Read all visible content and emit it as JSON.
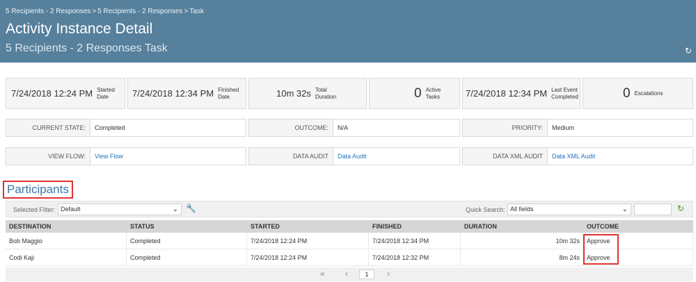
{
  "breadcrumb": [
    "5 Recipients - 2 Responses",
    "5 Recipients - 2 Responses",
    "Task"
  ],
  "header": {
    "title": "Activity Instance Detail",
    "subtitle": "5 Recipients - 2 Responses Task",
    "refresh_icon": "refresh-icon"
  },
  "stats": [
    {
      "value": "7/24/2018 12:24 PM",
      "label": "Started Date"
    },
    {
      "value": "7/24/2018 12:34 PM",
      "label": "Finished Date"
    },
    {
      "value": "10m 32s",
      "label": "Total Duration"
    },
    {
      "value": "0",
      "label": "Active Tasks"
    },
    {
      "value": "7/24/2018 12:34 PM",
      "label": "Last Event Completed"
    },
    {
      "value": "0",
      "label": "Escalations"
    }
  ],
  "info": {
    "current_state": {
      "key": "CURRENT STATE:",
      "value": "Completed"
    },
    "outcome": {
      "key": "OUTCOME:",
      "value": "N/A"
    },
    "priority": {
      "key": "PRIORITY:",
      "value": "Medium"
    },
    "view_flow": {
      "key": "VIEW FLOW:",
      "value": "View Flow"
    },
    "data_audit": {
      "key": "DATA AUDIT",
      "value": "Data Audit"
    },
    "data_xml_audit": {
      "key": "DATA XML AUDIT",
      "value": "Data XML Audit"
    }
  },
  "participants": {
    "title": "Participants",
    "filter_label": "Selected Filter:",
    "filter_value": "Default",
    "quick_search_label": "Quick Search:",
    "quick_search_value": "All fields",
    "columns": [
      "DESTINATION",
      "STATUS",
      "STARTED",
      "FINISHED",
      "DURATION",
      "OUTCOME"
    ],
    "rows": [
      {
        "destination": "Bob Maggio",
        "status": "Completed",
        "started": "7/24/2018 12:24 PM",
        "finished": "7/24/2018 12:34 PM",
        "duration": "10m 32s",
        "outcome": "Approve"
      },
      {
        "destination": "Codi Kaji",
        "status": "Completed",
        "started": "7/24/2018 12:24 PM",
        "finished": "7/24/2018 12:32 PM",
        "duration": "8m 24s",
        "outcome": "Approve"
      }
    ],
    "page": "1"
  },
  "colors": {
    "header_bg": "#56809c",
    "accent": "#3a76a8",
    "highlight": "#e03131",
    "link": "#1e73be"
  }
}
